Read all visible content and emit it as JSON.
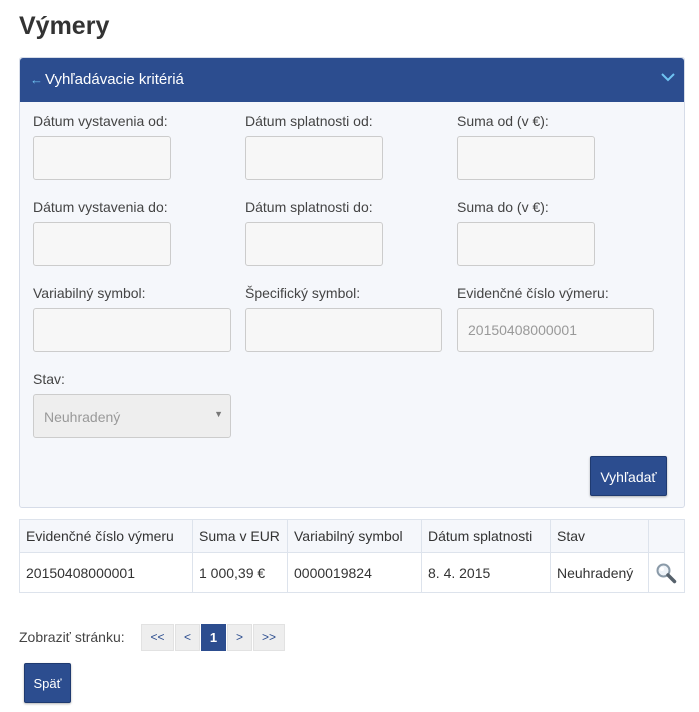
{
  "page": {
    "title": "Výmery"
  },
  "search_panel": {
    "title": "Vyhľadávacie kritériá",
    "fields": {
      "issue_date_from": {
        "label": "Dátum vystavenia od:",
        "value": ""
      },
      "due_date_from": {
        "label": "Dátum splatnosti od:",
        "value": ""
      },
      "amount_from": {
        "label": "Suma od (v €):",
        "value": ""
      },
      "issue_date_to": {
        "label": "Dátum vystavenia do:",
        "value": ""
      },
      "due_date_to": {
        "label": "Dátum splatnosti do:",
        "value": ""
      },
      "amount_to": {
        "label": "Suma do (v €):",
        "value": ""
      },
      "variable_symbol": {
        "label": "Variabilný symbol:",
        "value": ""
      },
      "specific_symbol": {
        "label": "Špecifický symbol:",
        "value": ""
      },
      "record_number": {
        "label": "Evidenčné číslo výmeru:",
        "value": "20150408000001"
      },
      "status": {
        "label": "Stav:",
        "value": "Neuhradený"
      }
    },
    "search_button": "Vyhľadať"
  },
  "results": {
    "columns": [
      "Evidenčné číslo výmeru",
      "Suma v EUR",
      "Variabilný symbol",
      "Dátum splatnosti",
      "Stav",
      ""
    ],
    "rows": [
      {
        "record_number": "20150408000001",
        "amount": "1 000,39 €",
        "variable_symbol": "0000019824",
        "due_date": "8. 4. 2015",
        "status": "Neuhradený",
        "action_icon": "magnifier-icon"
      }
    ]
  },
  "pagination": {
    "label": "Zobraziť stránku:",
    "first": "<<",
    "prev": "<",
    "current": "1",
    "next": ">",
    "last": ">>"
  },
  "back_button": "Späť",
  "colors": {
    "primary": "#2c4d8f",
    "header_icon": "#6fc3f2",
    "panel_bg": "#f5f7fb"
  }
}
